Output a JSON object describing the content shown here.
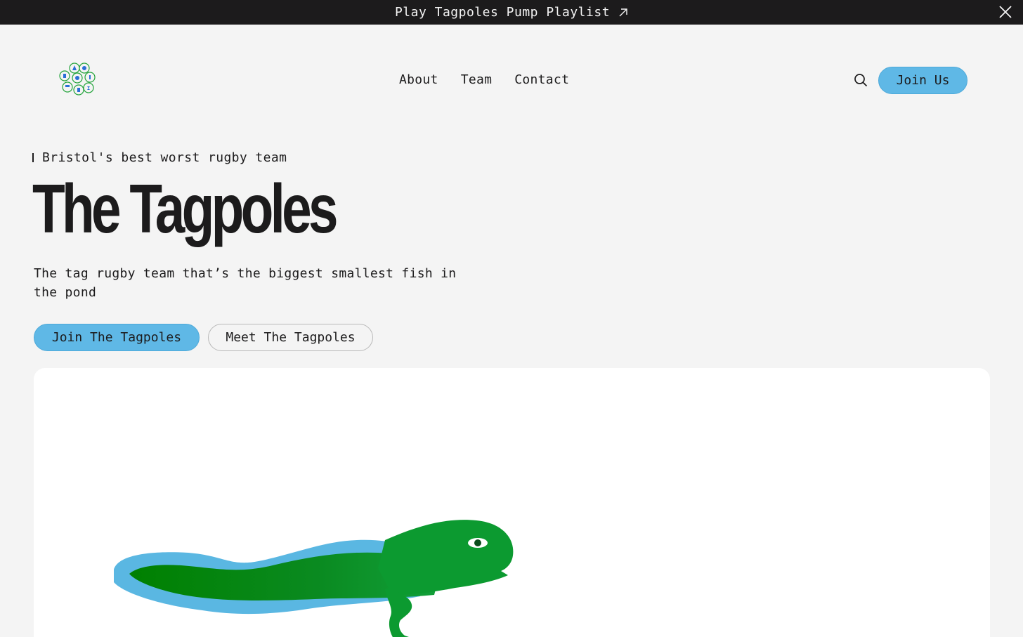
{
  "announcement": {
    "link_label": "Play Tagpoles Pump Playlist",
    "link_icon": "arrow-up-right-icon",
    "close_icon": "close-icon"
  },
  "header": {
    "logo_name": "tagpoles-logo",
    "nav": [
      {
        "label": "About"
      },
      {
        "label": "Team"
      },
      {
        "label": "Contact"
      }
    ],
    "search_icon": "search-icon",
    "cta_label": "Join Us"
  },
  "hero": {
    "eyebrow": "Bristol's best worst rugby team",
    "title": "The Tagpoles",
    "subtitle": "The tag rugby team that’s the biggest smallest fish in the pond",
    "primary_button": "Join The Tagpoles",
    "secondary_button": "Meet The Tagpoles"
  },
  "colors": {
    "accent_blue": "#5fb8e6",
    "dark": "#1c1b1c",
    "background": "#f4f4f4",
    "tadpole_green": "#0a8f2a"
  },
  "illustration": {
    "name": "tadpole-illustration"
  }
}
